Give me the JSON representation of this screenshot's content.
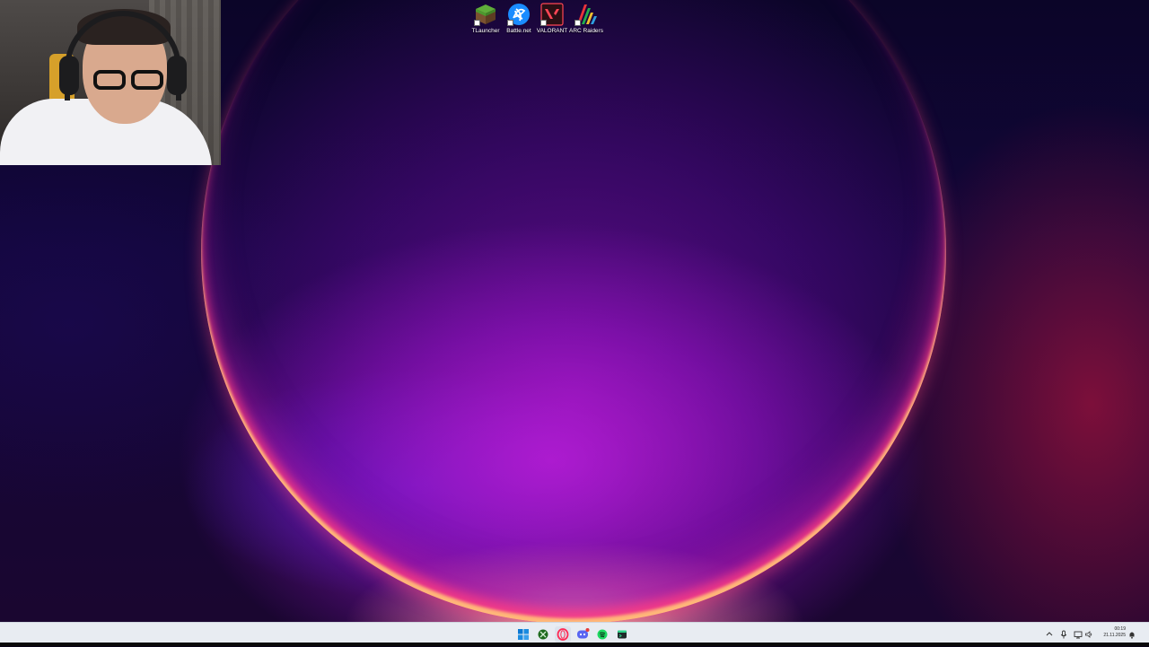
{
  "desktop": {
    "icons": [
      {
        "label": "TLauncher",
        "icon": "tlauncher-grass-block-icon"
      },
      {
        "label": "Battle.net",
        "icon": "battlenet-icon"
      },
      {
        "label": "VALORANT",
        "icon": "valorant-icon"
      },
      {
        "label": "ARC Raiders",
        "icon": "arc-raiders-icon"
      }
    ]
  },
  "taskbar": {
    "pinned": [
      {
        "name": "start-button",
        "icon": "windows-logo-icon"
      },
      {
        "name": "xbox-app",
        "icon": "xbox-icon"
      },
      {
        "name": "opera-gx-browser",
        "icon": "opera-icon"
      },
      {
        "name": "discord-app",
        "icon": "discord-icon"
      },
      {
        "name": "spotify-app",
        "icon": "spotify-icon"
      },
      {
        "name": "terminal-app",
        "icon": "terminal-icon"
      }
    ],
    "tray": {
      "icons": [
        "chevron-up-icon",
        "microphone-icon",
        "network-icon",
        "volume-icon"
      ],
      "time": "00:19",
      "date": "21.11.2025",
      "notification_icon": "notification-bell-icon"
    }
  },
  "colors": {
    "taskbar_bg": "#e8ecf2",
    "wallpaper_glow": "#c020d8",
    "wallpaper_rim": "#ff4b7a"
  }
}
